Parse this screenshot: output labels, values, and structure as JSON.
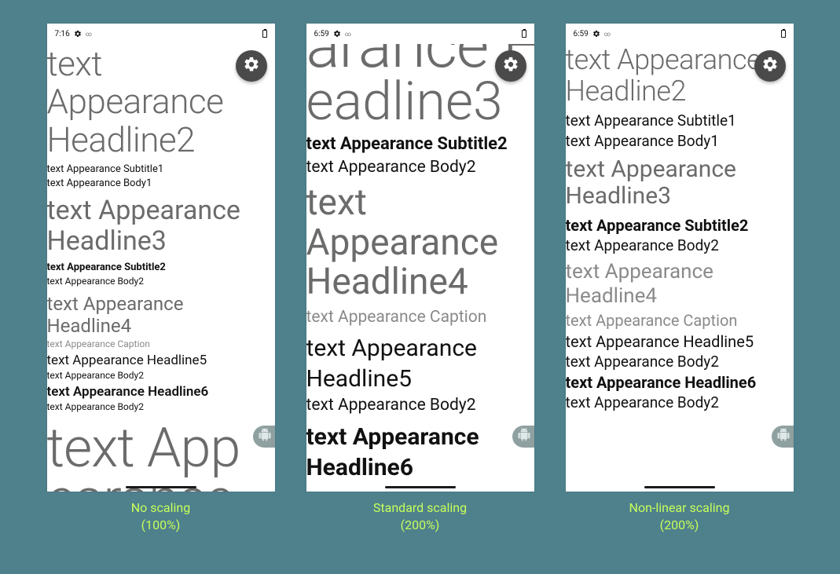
{
  "captions": {
    "none_line1": "No scaling",
    "none_line2": "(100%)",
    "std_line1": "Standard scaling",
    "std_line2": "(200%)",
    "nl_line1": "Non-linear scaling",
    "nl_line2": "(200%)"
  },
  "status": {
    "time_none": "7:16",
    "time_std": "6:59",
    "time_nl": "6:59",
    "dots": "∞"
  },
  "panel_none": {
    "h2": "text Appearance Headline2",
    "sub1": "text Appearance Subtitle1",
    "body1": "text Appearance Body1",
    "h3": "text Appearance Headline3",
    "sub2": "text Appearance Subtitle2",
    "body2a": "text Appearance Body2",
    "h4": "text Appearance Headline4",
    "cap": "text Appearance Caption",
    "h5": "text Appearance Headline5",
    "body2b": "text Appearance Body2",
    "h6": "text Appearance Headline6",
    "body2c": "text Appearance Body2",
    "huge1": "text App",
    "huge2": "earance"
  },
  "panel_std": {
    "cut1": "arance H",
    "cut2": "eadline3",
    "sub2": "text Appearance Subtitle2",
    "body2a": "text Appearance Body2",
    "h4": "text Appearance Headline4",
    "cap": "text Appearance Caption",
    "h5": "text Appearance Headline5",
    "body2b": "text Appearance Body2",
    "h6": "text Appearance Headline6"
  },
  "panel_nl": {
    "h2": "text Appearance Headline2",
    "sub1": "text Appearance Subtitle1",
    "body1": "text Appearance Body1",
    "h3": "text Appearance Headline3",
    "sub2": "text Appearance Subtitle2",
    "body2a": "text Appearance Body2",
    "h4": "text Appearance Headline4",
    "cap": "text Appearance Caption",
    "h5": "text Appearance Headline5",
    "body2b": "text Appearance Body2",
    "h6": "text Appearance Headline6",
    "body2c": "text Appearance Body2"
  }
}
